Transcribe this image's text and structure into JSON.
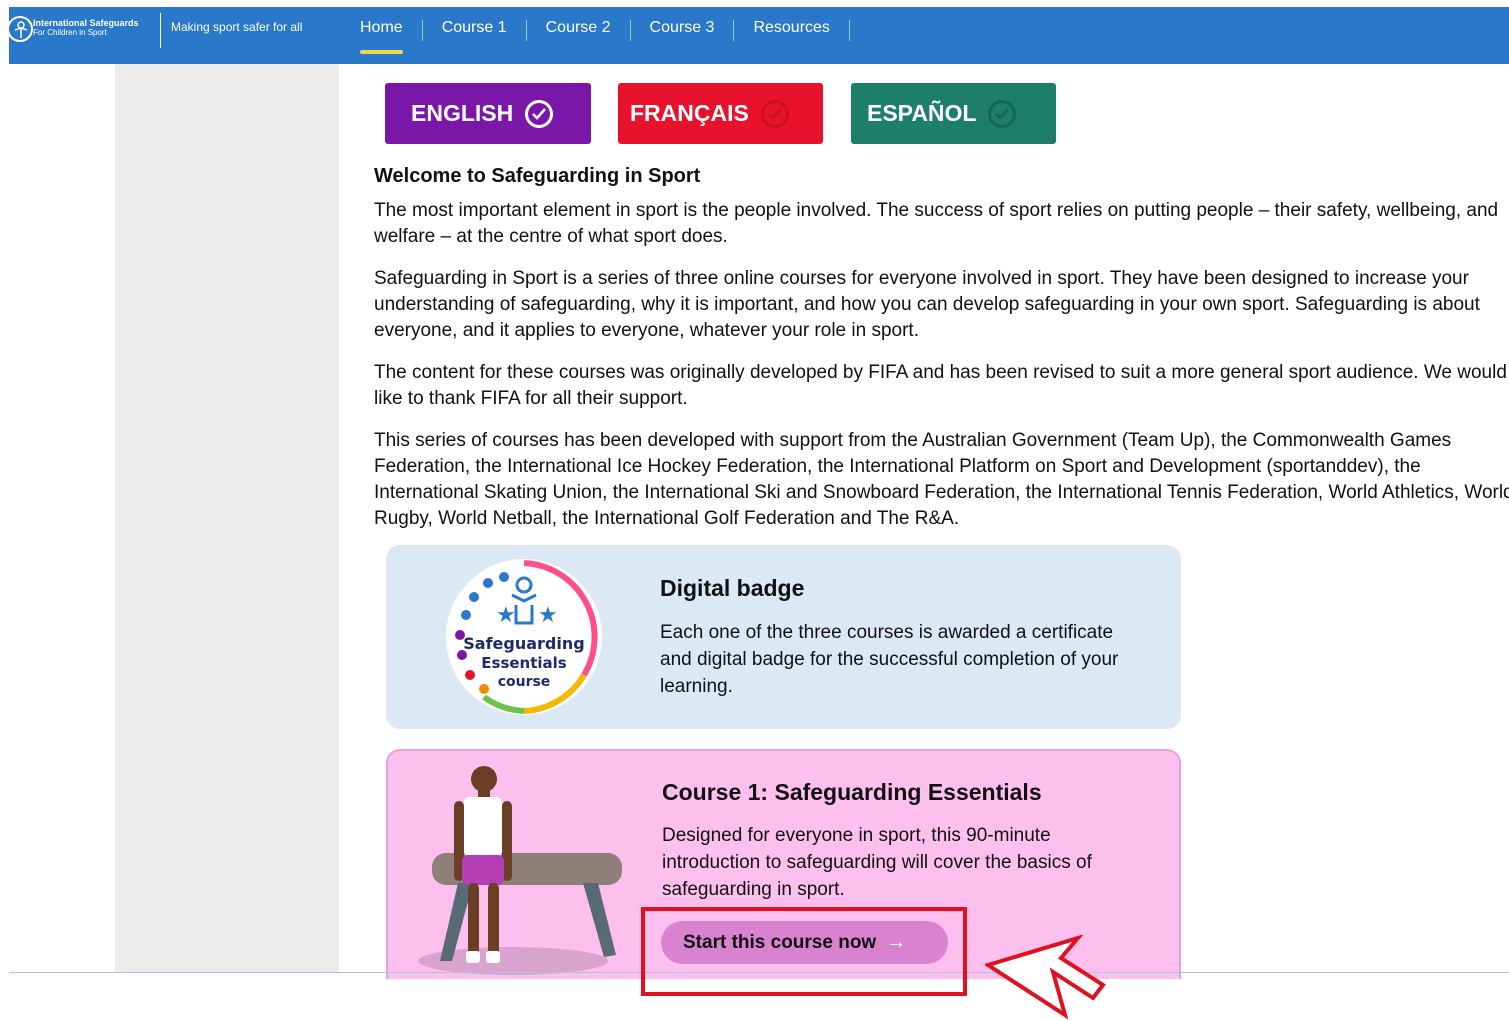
{
  "header": {
    "logo_title": "International Safeguards",
    "logo_subtitle": "For Children in Sport",
    "tagline": "Making sport safer for all",
    "nav": [
      {
        "label": "Home",
        "active": true
      },
      {
        "label": "Course 1",
        "active": false
      },
      {
        "label": "Course 2",
        "active": false
      },
      {
        "label": "Course 3",
        "active": false
      },
      {
        "label": "Resources",
        "active": false
      }
    ]
  },
  "languages": [
    {
      "label": "ENGLISH",
      "color": "#7b17a8"
    },
    {
      "label": "FRANÇAIS",
      "color": "#e8122c"
    },
    {
      "label": "ESPAÑOL",
      "color": "#1e7f69"
    }
  ],
  "main": {
    "heading": "Welcome to Safeguarding in Sport",
    "paragraphs": [
      "The most important element in sport is the people involved. The success of sport relies on putting people – their safety, wellbeing, and welfare – at the centre of what sport does.",
      "Safeguarding in Sport is a series of three online courses for everyone involved in sport. They have been designed to increase your understanding of safeguarding, why it is important, and how you can develop safeguarding in your own sport. Safeguarding is about everyone, and it applies to everyone, whatever your role in sport.",
      "The content for these courses was originally developed by FIFA and has been revised to suit a more general sport audience. We would like to thank FIFA for all their support.",
      "This series of courses has been developed with support from the Australian Government (Team Up), the Commonwealth Games Federation, the International Ice Hockey Federation, the International Platform on Sport and Development (sportanddev), the International Skating Union, the International Ski and Snowboard Federation, the International Tennis Federation, World Athletics, World Rugby, World Netball, the International Golf Federation and The R&A."
    ]
  },
  "badge_card": {
    "title": "Digital badge",
    "description": "Each one of the three courses is awarded a certificate and digital badge for the successful completion of your learning.",
    "badge_text": [
      "Safeguarding",
      "Essentials",
      "course"
    ]
  },
  "course_card": {
    "title": "Course 1: Safeguarding Essentials",
    "description": "Designed for everyone in sport, this 90-minute introduction to safeguarding will cover the basics of safeguarding in sport.",
    "button_label": "Start this course now"
  },
  "colors": {
    "nav_bg": "#2a78c9",
    "badge_card_bg": "#dce9f4",
    "course_card_bg": "#fdc0ee",
    "button_bg": "#d982cf",
    "highlight": "#e0101e"
  }
}
